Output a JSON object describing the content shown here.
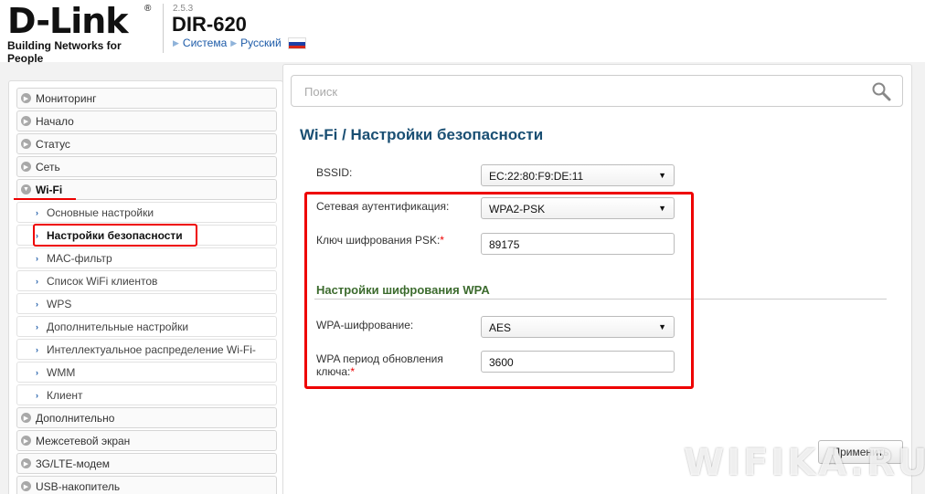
{
  "header": {
    "logo_text": "D-Link",
    "logo_reg": "®",
    "logo_tagline": "Building Networks for People",
    "version": "2.5.3",
    "model": "DIR-620",
    "system_link": "Система",
    "language_link": "Русский"
  },
  "sidebar": {
    "items": [
      {
        "label": "Мониторинг"
      },
      {
        "label": "Начало"
      },
      {
        "label": "Статус"
      },
      {
        "label": "Сеть"
      },
      {
        "label": "Wi-Fi"
      },
      {
        "label": "Дополнительно"
      },
      {
        "label": "Межсетевой экран"
      },
      {
        "label": "3G/LTE-модем"
      },
      {
        "label": "USB-накопитель"
      }
    ],
    "wifi_sub": [
      {
        "label": "Основные настройки"
      },
      {
        "label": "Настройки безопасности"
      },
      {
        "label": "MAC-фильтр"
      },
      {
        "label": "Список WiFi клиентов"
      },
      {
        "label": "WPS"
      },
      {
        "label": "Дополнительные настройки"
      },
      {
        "label": "Интеллектуальное распределение Wi-Fi-"
      },
      {
        "label": "WMM"
      },
      {
        "label": "Клиент"
      }
    ]
  },
  "search": {
    "placeholder": "Поиск"
  },
  "page": {
    "title": "Wi-Fi /  Настройки безопасности",
    "bssid_label": "BSSID:",
    "bssid_value": "EC:22:80:F9:DE:11",
    "auth_label": "Сетевая аутентификация:",
    "auth_value": "WPA2-PSK",
    "psk_label": "Ключ шифрования PSK:",
    "psk_value": "89175",
    "wpa_section": "Настройки шифрования WPA",
    "wpa_enc_label": "WPA-шифрование:",
    "wpa_enc_value": "AES",
    "wpa_period_label_1": "WPA период обновления",
    "wpa_period_label_2": "ключа:",
    "wpa_period_value": "3600",
    "required_mark": "*",
    "apply_label": "Применить"
  },
  "watermark": "WIFIKA.RU",
  "colors": {
    "accent_blue": "#1d5ba8",
    "title": "#1a4f73",
    "section": "#3c6b2e",
    "annotation_red": "#e00000"
  }
}
